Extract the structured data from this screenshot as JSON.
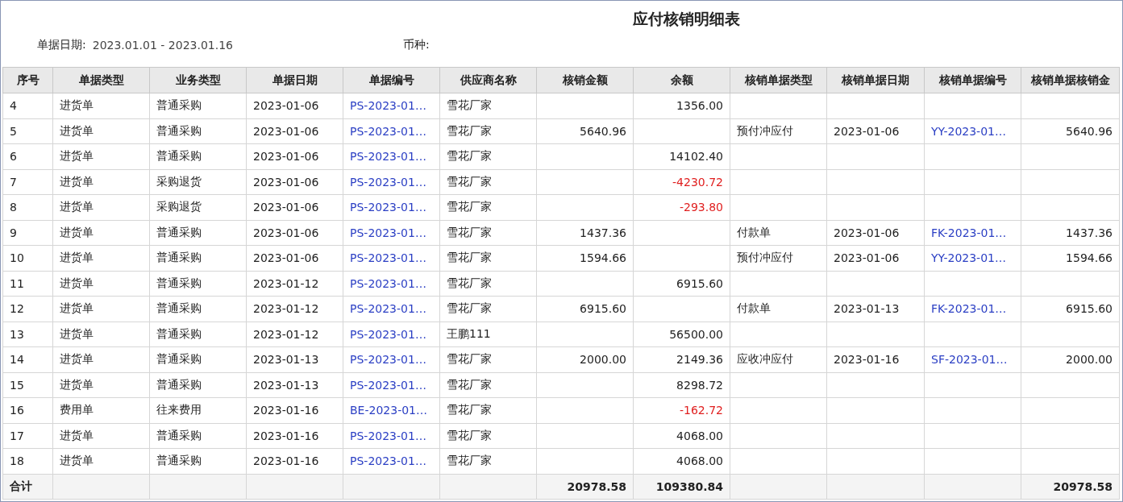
{
  "title": "应付核销明细表",
  "filters": [
    {
      "label": "单据日期:",
      "value": "2023.01.01 - 2023.01.16"
    },
    {
      "label": "币种:"
    }
  ],
  "columns": [
    "序号",
    "单据类型",
    "业务类型",
    "单据日期",
    "单据编号",
    "供应商名称",
    "核销金额",
    "余额",
    "核销单据类型",
    "核销单据日期",
    "核销单据编号",
    "核销单据核销金"
  ],
  "rows": [
    {
      "no": "4",
      "type": "进货单",
      "biz": "普通采购",
      "date": "2023-01-06",
      "doc_no": "PS-2023-01…",
      "supplier": "雪花厂家",
      "balance": "1356.00",
      "balance_negative": false
    },
    {
      "no": "5",
      "type": "进货单",
      "biz": "普通采购",
      "date": "2023-01-06",
      "doc_no": "PS-2023-01…",
      "supplier": "雪花厂家",
      "amount": "5640.96",
      "wo_type": "预付冲应付",
      "wo_date": "2023-01-06",
      "wo_no": "YY-2023-01…",
      "wo_amount": "5640.96"
    },
    {
      "no": "6",
      "type": "进货单",
      "biz": "普通采购",
      "date": "2023-01-06",
      "doc_no": "PS-2023-01…",
      "supplier": "雪花厂家",
      "balance": "14102.40",
      "balance_negative": false
    },
    {
      "no": "7",
      "type": "进货单",
      "biz": "采购退货",
      "date": "2023-01-06",
      "doc_no": "PS-2023-01…",
      "supplier": "雪花厂家",
      "balance": "-4230.72",
      "balance_negative": true
    },
    {
      "no": "8",
      "type": "进货单",
      "biz": "采购退货",
      "date": "2023-01-06",
      "doc_no": "PS-2023-01…",
      "supplier": "雪花厂家",
      "balance": "-293.80",
      "balance_negative": true
    },
    {
      "no": "9",
      "type": "进货单",
      "biz": "普通采购",
      "date": "2023-01-06",
      "doc_no": "PS-2023-01…",
      "supplier": "雪花厂家",
      "amount": "1437.36",
      "wo_type": "付款单",
      "wo_date": "2023-01-06",
      "wo_no": "FK-2023-01…",
      "wo_amount": "1437.36"
    },
    {
      "no": "10",
      "type": "进货单",
      "biz": "普通采购",
      "date": "2023-01-06",
      "doc_no": "PS-2023-01…",
      "supplier": "雪花厂家",
      "amount": "1594.66",
      "wo_type": "预付冲应付",
      "wo_date": "2023-01-06",
      "wo_no": "YY-2023-01…",
      "wo_amount": "1594.66"
    },
    {
      "no": "11",
      "type": "进货单",
      "biz": "普通采购",
      "date": "2023-01-12",
      "doc_no": "PS-2023-01…",
      "supplier": "雪花厂家",
      "balance": "6915.60",
      "balance_negative": false
    },
    {
      "no": "12",
      "type": "进货单",
      "biz": "普通采购",
      "date": "2023-01-12",
      "doc_no": "PS-2023-01…",
      "supplier": "雪花厂家",
      "amount": "6915.60",
      "wo_type": "付款单",
      "wo_date": "2023-01-13",
      "wo_no": "FK-2023-01…",
      "wo_amount": "6915.60"
    },
    {
      "no": "13",
      "type": "进货单",
      "biz": "普通采购",
      "date": "2023-01-12",
      "doc_no": "PS-2023-01…",
      "supplier": "王鹏111",
      "balance": "56500.00",
      "balance_negative": false
    },
    {
      "no": "14",
      "type": "进货单",
      "biz": "普通采购",
      "date": "2023-01-13",
      "doc_no": "PS-2023-01…",
      "supplier": "雪花厂家",
      "amount": "2000.00",
      "balance": "2149.36",
      "balance_negative": false,
      "wo_type": "应收冲应付",
      "wo_date": "2023-01-16",
      "wo_no": "SF-2023-01…",
      "wo_amount": "2000.00"
    },
    {
      "no": "15",
      "type": "进货单",
      "biz": "普通采购",
      "date": "2023-01-13",
      "doc_no": "PS-2023-01…",
      "supplier": "雪花厂家",
      "balance": "8298.72",
      "balance_negative": false
    },
    {
      "no": "16",
      "type": "费用单",
      "biz": "往来费用",
      "date": "2023-01-16",
      "doc_no": "BE-2023-01…",
      "supplier": "雪花厂家",
      "balance": "-162.72",
      "balance_negative": true
    },
    {
      "no": "17",
      "type": "进货单",
      "biz": "普通采购",
      "date": "2023-01-16",
      "doc_no": "PS-2023-01…",
      "supplier": "雪花厂家",
      "balance": "4068.00",
      "balance_negative": false
    },
    {
      "no": "18",
      "type": "进货单",
      "biz": "普通采购",
      "date": "2023-01-16",
      "doc_no": "PS-2023-01…",
      "supplier": "雪花厂家",
      "balance": "4068.00",
      "balance_negative": false
    }
  ],
  "totals": {
    "label": "合计",
    "amount": "20978.58",
    "balance": "109380.84",
    "wo_amount": "20978.58"
  }
}
